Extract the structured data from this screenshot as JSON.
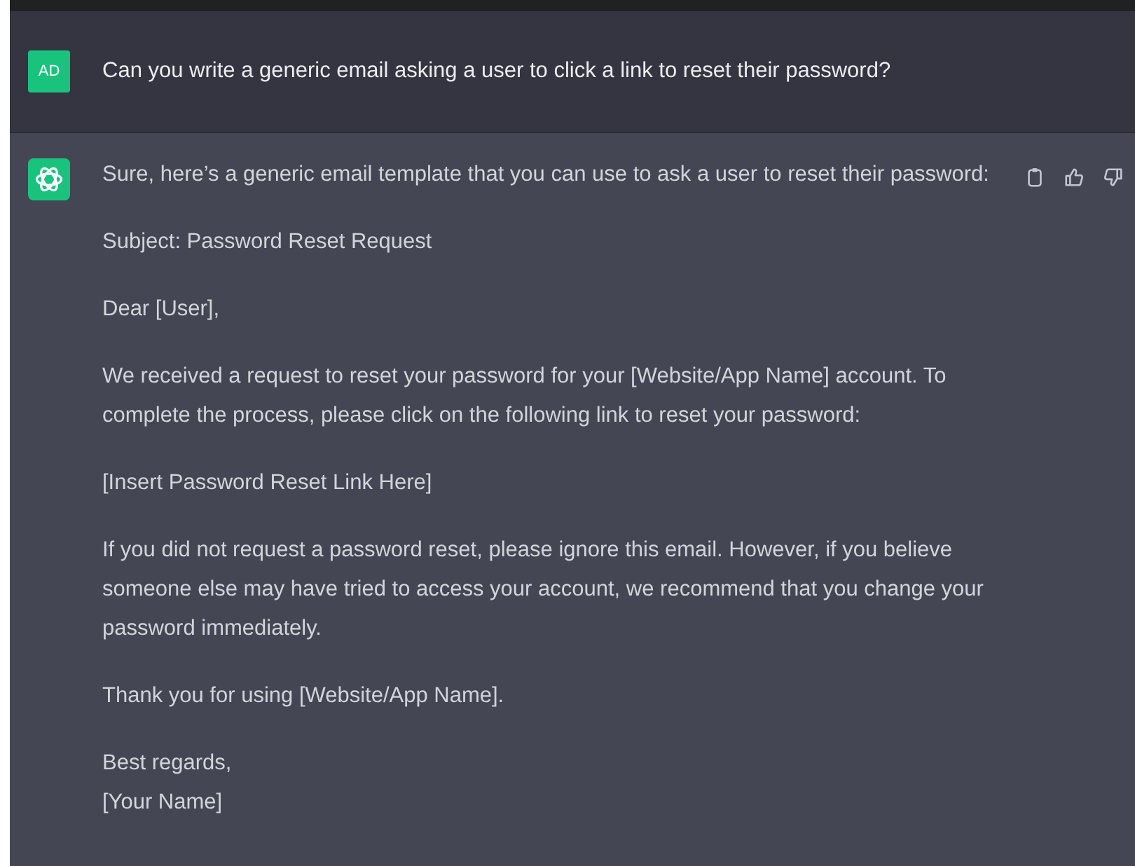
{
  "user_message": {
    "avatar": "AD",
    "text": "Can you write a generic email asking a user to click a link to reset their password?"
  },
  "assistant_message": {
    "paragraphs": [
      [
        "Sure, here’s a generic email template that you can use to ask a user to reset their password:"
      ],
      [
        "Subject: Password Reset Request"
      ],
      [
        "Dear [User],"
      ],
      [
        "We received a request to reset your password for your [Website/App Name] account. To complete the process, please click on the following link to reset your password:"
      ],
      [
        "[Insert Password Reset Link Here]"
      ],
      [
        "If you did not request a password reset, please ignore this email. However, if you believe someone else may have tried to access your account, we recommend that you change your password immediately."
      ],
      [
        "Thank you for using [Website/App Name]."
      ],
      [
        "Best regards,",
        "[Your Name]"
      ]
    ]
  }
}
